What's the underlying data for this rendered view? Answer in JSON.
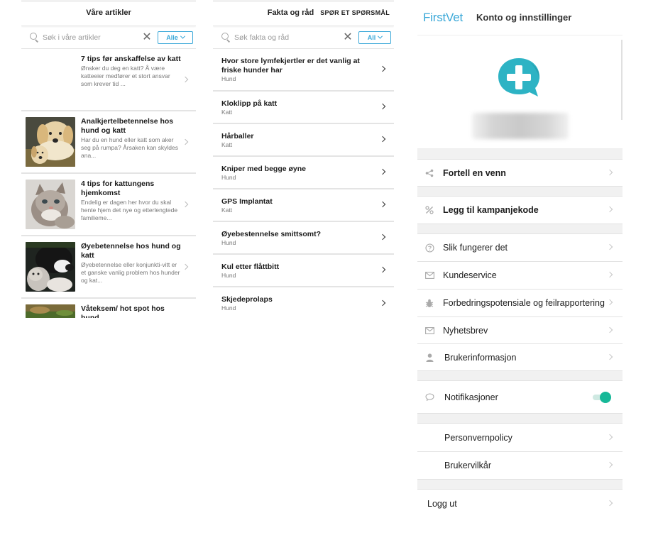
{
  "articles_screen": {
    "title": "Våre artikler",
    "search": {
      "placeholder": "Søk i våre artikler",
      "value": ""
    },
    "filter_label": "Alle",
    "items": [
      {
        "title": "7 tips før anskaffelse av katt",
        "excerpt": "Ønsker du deg en katt? Å være katteeier medfører et stort ansvar som krever tid ...",
        "image": "none"
      },
      {
        "title": "Analkjertelbetennelse hos hund og katt",
        "excerpt": "Har du en hund eller katt som aker seg på rumpa? Årsaken kan skyldes ana...",
        "image": "dogs-photo"
      },
      {
        "title": "4 tips for kattungens hjemkomst",
        "excerpt": "Endelig er dagen her hvor du skal hente hjem det nye og etterlengtede familieme...",
        "image": "kitten-photo"
      },
      {
        "title": "Øyebetennelse  hos hund og katt",
        "excerpt": "Øyebetennelse eller konjunkti-vitt er et ganske vanlig problem hos hunder og kat...",
        "image": "dog-cat-photo"
      },
      {
        "title": "Våteksem/ hot spot hos hund",
        "excerpt": "",
        "image": "grass-photo"
      }
    ]
  },
  "facts_screen": {
    "title": "Fakta og råd",
    "action": "SPØR ET SPØRSMÅL",
    "search": {
      "placeholder": "Søk fakta og råd",
      "value": ""
    },
    "filter_label": "All",
    "items": [
      {
        "title": "Hvor store  lymfekjertler er det vanlig at friske hunder har",
        "category": "Hund"
      },
      {
        "title": "Kloklipp på katt",
        "category": "Katt"
      },
      {
        "title": "Hårballer",
        "category": "Katt"
      },
      {
        "title": "Kniper med begge øyne",
        "category": "Hund"
      },
      {
        "title": "GPS Implantat",
        "category": "Katt"
      },
      {
        "title": "Øyebestennelse smittsomt?",
        "category": "Hund"
      },
      {
        "title": "Kul etter flåttbitt",
        "category": "Hund"
      },
      {
        "title": "Skjedeprolaps",
        "category": "Hund"
      }
    ]
  },
  "account_screen": {
    "brand": "FirstVet",
    "title": "Konto og innstillinger",
    "user_name_blurred": true,
    "rows": {
      "tell_friend": {
        "label": "Fortell en venn",
        "icon": "share-icon"
      },
      "campaign_code": {
        "label": "Legg til kampanjekode",
        "icon": "percent-icon"
      },
      "how_it_works": {
        "label": "Slik fungerer det",
        "icon": "question-circle-icon"
      },
      "customer_service": {
        "label": "Kundeservice",
        "icon": "envelope-icon"
      },
      "feedback": {
        "label": "Forbedringspotensiale og feilrapportering",
        "icon": "bug-icon"
      },
      "newsletter": {
        "label": "Nyhetsbrev",
        "icon": "envelope-icon"
      },
      "user_info": {
        "label": "Brukerinformasjon",
        "icon": "user-icon"
      },
      "notifications": {
        "label": "Notifikasjoner",
        "icon": "speech-bubble-icon",
        "enabled": true
      },
      "privacy": {
        "label": "Personvernpolicy"
      },
      "terms": {
        "label": "Brukervilkår"
      },
      "logout": {
        "label": "Logg ut"
      }
    }
  },
  "colors": {
    "brand_blue": "#3aa8d8",
    "logo_teal": "#2db3c4",
    "toggle_on": "#17b898",
    "section_gap": "#f1f1f1"
  }
}
